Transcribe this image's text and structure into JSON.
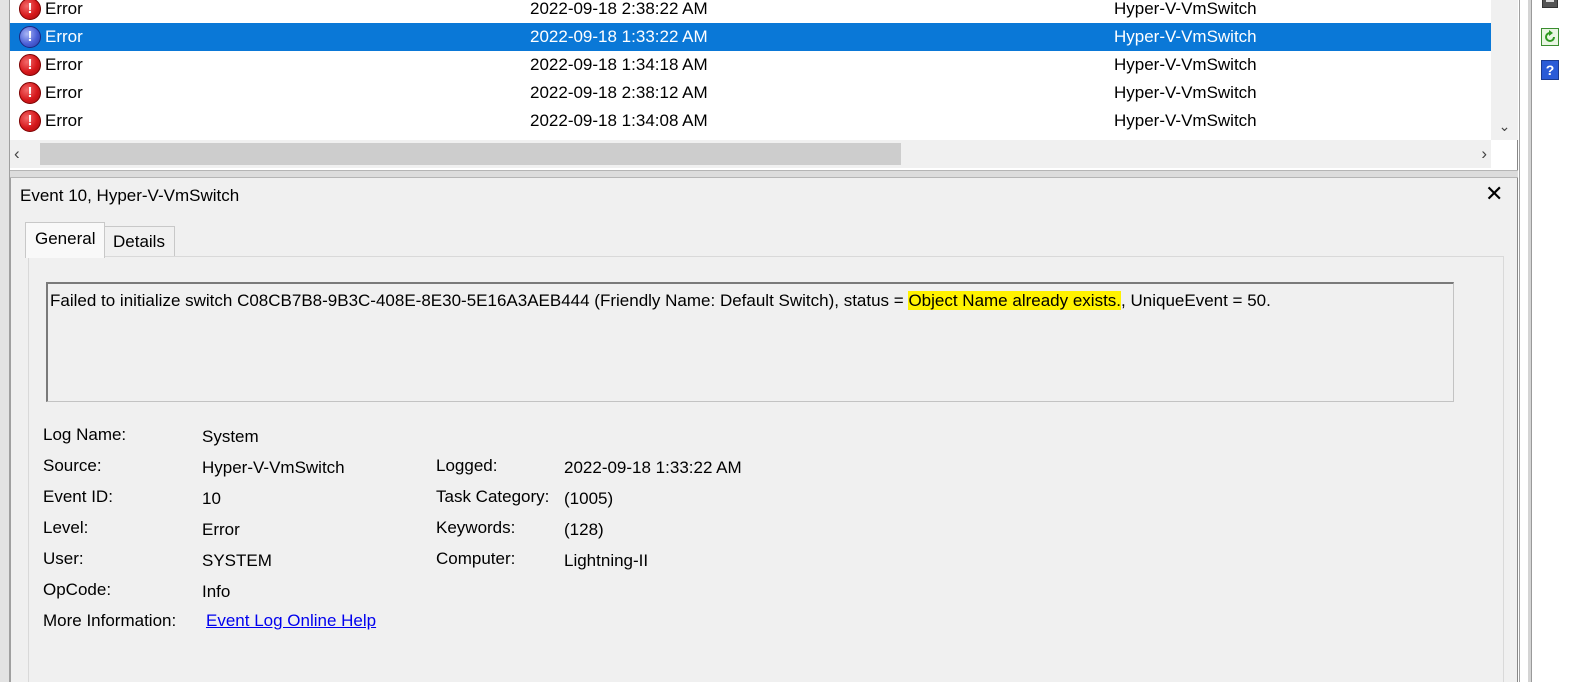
{
  "events": [
    {
      "level": "Error",
      "date": "2022-09-18 2:38:22 AM",
      "source": "Hyper-V-VmSwitch",
      "selected": false
    },
    {
      "level": "Error",
      "date": "2022-09-18 1:33:22 AM",
      "source": "Hyper-V-VmSwitch",
      "selected": true
    },
    {
      "level": "Error",
      "date": "2022-09-18 1:34:18 AM",
      "source": "Hyper-V-VmSwitch",
      "selected": false
    },
    {
      "level": "Error",
      "date": "2022-09-18 2:38:12 AM",
      "source": "Hyper-V-VmSwitch",
      "selected": false
    },
    {
      "level": "Error",
      "date": "2022-09-18 1:34:08 AM",
      "source": "Hyper-V-VmSwitch",
      "selected": false
    }
  ],
  "detail": {
    "title": "Event 10, Hyper-V-VmSwitch",
    "tabs": {
      "general": "General",
      "details": "Details"
    },
    "description": {
      "before": "Failed to initialize switch C08CB7B8-9B3C-408E-8E30-5E16A3AEB444 (Friendly Name: Default Switch), status = ",
      "highlight": "Object Name already exists.",
      "after": ", UniqueEvent = 50."
    },
    "props": {
      "log_name_label": "Log Name:",
      "log_name": "System",
      "source_label": "Source:",
      "source": "Hyper-V-VmSwitch",
      "logged_label": "Logged:",
      "logged": "2022-09-18 1:33:22 AM",
      "event_id_label": "Event ID:",
      "event_id": "10",
      "task_category_label": "Task Category:",
      "task_category": "(1005)",
      "level_label": "Level:",
      "level": "Error",
      "keywords_label": "Keywords:",
      "keywords": "(128)",
      "user_label": "User:",
      "user": "SYSTEM",
      "computer_label": "Computer:",
      "computer": "Lightning-II",
      "opcode_label": "OpCode:",
      "opcode": "Info",
      "more_info_label": "More Information:",
      "more_info_link": "Event Log Online Help"
    }
  },
  "actions_icons": [
    "save-icon",
    "refresh-icon",
    "help-icon"
  ],
  "colors": {
    "selection": "#0a78d7",
    "highlight": "#fff200",
    "link": "#0000ee",
    "error": "#d6181b"
  }
}
